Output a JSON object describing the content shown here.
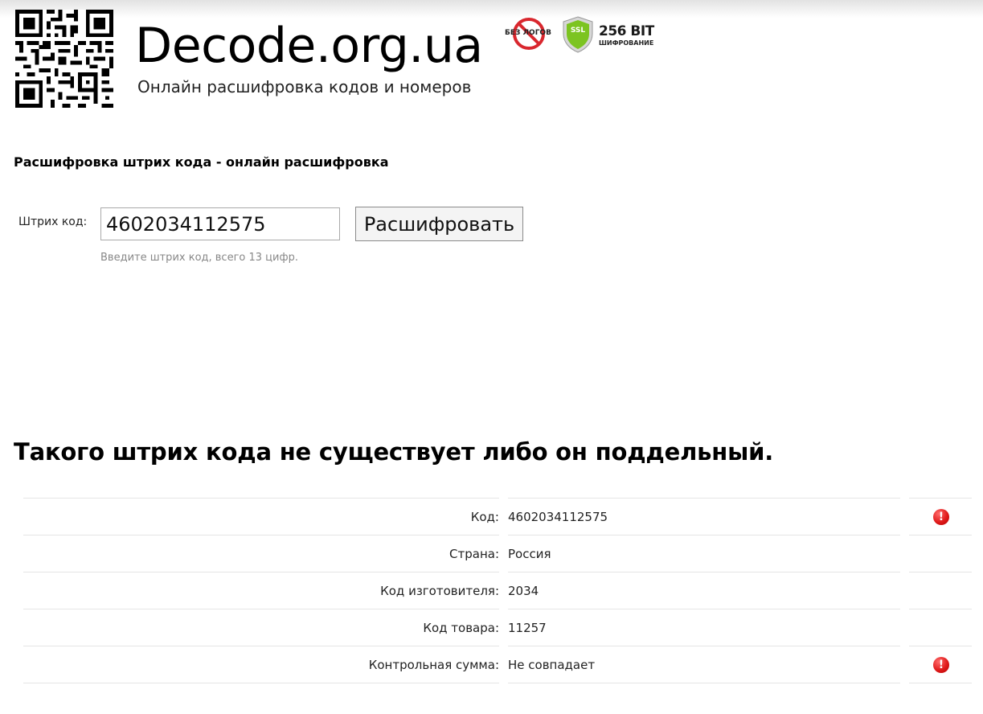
{
  "header": {
    "site_title": "Decode.org.ua",
    "subtitle": "Онлайн расшифровка кодов и номеров",
    "qr_icon": "qr-code-icon",
    "badges": {
      "no_logs_label": "БЕЗ ЛОГОВ",
      "ssl_shield_label": "SSL",
      "ssl_bits": "256 BIT",
      "ssl_caption": "ШИФРОВАНИЕ"
    }
  },
  "form": {
    "heading": "Расшифровка штрих кода - онлайн расшифровка",
    "label": "Штрих код:",
    "input_value": "4602034112575",
    "button_label": "Расшифровать",
    "hint": "Введите штрих код, всего 13 цифр."
  },
  "result": {
    "heading": "Такого штрих кода не существует либо он поддельный.",
    "rows": [
      {
        "label": "Код:",
        "value": "4602034112575",
        "status": "error"
      },
      {
        "label": "Страна:",
        "value": "Россия",
        "status": ""
      },
      {
        "label": "Код изготовителя:",
        "value": "2034",
        "status": ""
      },
      {
        "label": "Код товара:",
        "value": "11257",
        "status": ""
      },
      {
        "label": "Контрольная сумма:",
        "value": "Не совпадает",
        "status": "error"
      }
    ]
  },
  "colors": {
    "error": "#e01b1b",
    "ssl_green": "#7cc421",
    "no_logs_red": "#d9272e"
  }
}
